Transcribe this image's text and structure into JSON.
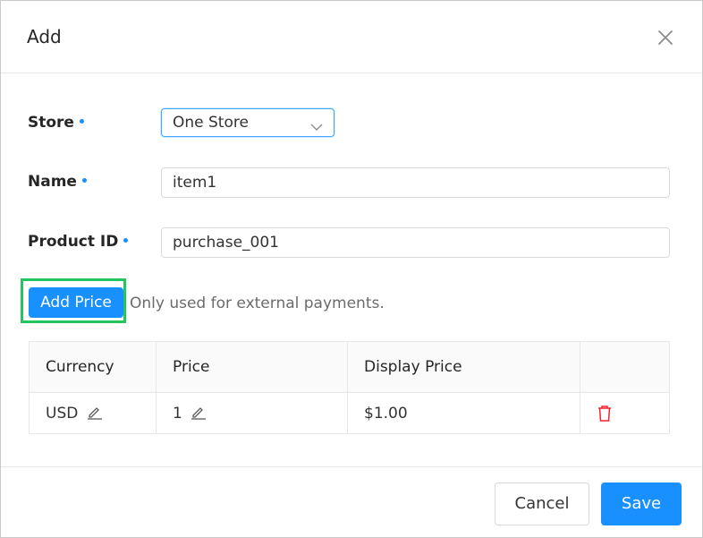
{
  "dialog": {
    "title": "Add",
    "close_icon": "close-icon"
  },
  "form": {
    "store": {
      "label": "Store",
      "value": "One Store"
    },
    "name": {
      "label": "Name",
      "value": "item1"
    },
    "product_id": {
      "label": "Product ID",
      "value": "purchase_001"
    },
    "add_price_label": "Add Price",
    "hint": "Only used for external payments."
  },
  "table": {
    "headers": [
      "Currency",
      "Price",
      "Display Price",
      ""
    ],
    "rows": [
      {
        "currency": "USD",
        "price": "1",
        "display_price": "$1.00"
      }
    ]
  },
  "footer": {
    "cancel_label": "Cancel",
    "save_label": "Save"
  },
  "colors": {
    "primary": "#1890ff",
    "required_dot": "#1890ff",
    "delete": "#f5222d",
    "highlight": "#22c55e"
  }
}
